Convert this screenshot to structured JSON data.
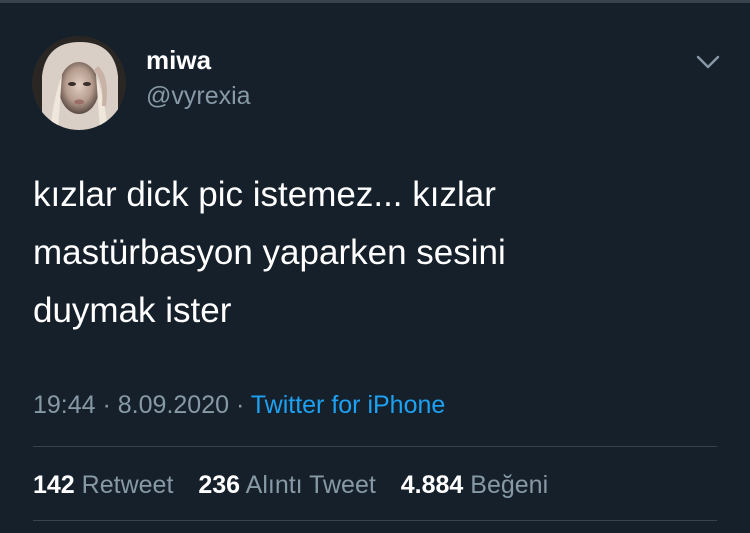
{
  "user": {
    "name": "miwa",
    "handle": "@vyrexia"
  },
  "tweet": {
    "line1": "kızlar dick pic istemez... kızlar",
    "line2": "mastürbasyon yaparken sesini",
    "line3": "duymak ister"
  },
  "meta": {
    "time": "19:44",
    "sep1": " · ",
    "date": "8.09.2020",
    "sep2": " · ",
    "source": "Twitter for iPhone"
  },
  "stats": {
    "retweets_count": "142",
    "retweets_label": "Retweet",
    "quotes_count": "236",
    "quotes_label": "Alıntı Tweet",
    "likes_count": "4.884",
    "likes_label": "Beğeni"
  },
  "colors": {
    "background": "#15202b",
    "text": "#ffffff",
    "secondary": "#8899a6",
    "link": "#1da1f2",
    "divider": "#38444d"
  },
  "icons": {
    "menu": "chevron-down-icon"
  }
}
